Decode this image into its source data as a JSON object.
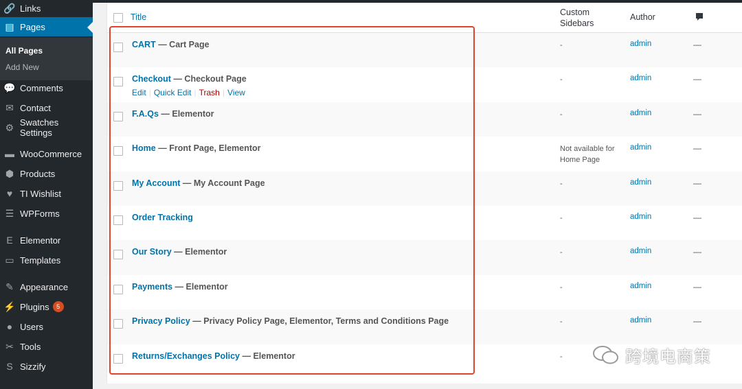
{
  "sidebar": {
    "items": [
      {
        "label": "Links",
        "icon": "link-icon",
        "glyph": "🔗"
      },
      {
        "label": "Pages",
        "icon": "pages-icon",
        "glyph": "▤"
      },
      {
        "label": "Comments",
        "icon": "comment-icon",
        "glyph": "💬"
      },
      {
        "label": "Contact",
        "icon": "mail-icon",
        "glyph": "✉"
      },
      {
        "label": "Swatches Settings",
        "icon": "gear-icon",
        "glyph": "⚙"
      },
      {
        "label": "WooCommerce",
        "icon": "woo-icon",
        "glyph": "▬"
      },
      {
        "label": "Products",
        "icon": "box-icon",
        "glyph": "⬢"
      },
      {
        "label": "TI Wishlist",
        "icon": "heart-icon",
        "glyph": "♥"
      },
      {
        "label": "WPForms",
        "icon": "form-icon",
        "glyph": "☰"
      },
      {
        "label": "Elementor",
        "icon": "elementor-icon",
        "glyph": "E"
      },
      {
        "label": "Templates",
        "icon": "folder-icon",
        "glyph": "▭"
      },
      {
        "label": "Appearance",
        "icon": "brush-icon",
        "glyph": "✎"
      },
      {
        "label": "Plugins",
        "icon": "plug-icon",
        "glyph": "⚡",
        "badge": "5"
      },
      {
        "label": "Users",
        "icon": "user-icon",
        "glyph": "●"
      },
      {
        "label": "Tools",
        "icon": "wrench-icon",
        "glyph": "✂"
      },
      {
        "label": "Sizzify",
        "icon": "sizzify-icon",
        "glyph": "S"
      }
    ],
    "submenu": {
      "all_pages": "All Pages",
      "add_new": "Add New"
    }
  },
  "table": {
    "headers": {
      "title": "Title",
      "custom_sidebars_1": "Custom",
      "custom_sidebars_2": "Sidebars",
      "author": "Author",
      "comments_icon": "comment-bubble-icon"
    },
    "row_actions": {
      "edit": "Edit",
      "quick_edit": "Quick Edit",
      "trash": "Trash",
      "view": "View",
      "sep": "|"
    },
    "rows": [
      {
        "title": "CART",
        "state": "— Cart Page",
        "sidebars": "-",
        "author": "admin",
        "comments": "—"
      },
      {
        "title": "Checkout",
        "state": "— Checkout Page",
        "sidebars": "-",
        "author": "admin",
        "comments": "—"
      },
      {
        "title": "F.A.Qs",
        "state": "— Elementor",
        "sidebars": "-",
        "author": "admin",
        "comments": "—"
      },
      {
        "title": "Home",
        "state": "— Front Page, Elementor",
        "sidebars": "Not available for Home Page",
        "author": "admin",
        "comments": "—"
      },
      {
        "title": "My Account",
        "state": "— My Account Page",
        "sidebars": "-",
        "author": "admin",
        "comments": "—"
      },
      {
        "title": "Order Tracking",
        "state": "",
        "sidebars": "-",
        "author": "admin",
        "comments": "—"
      },
      {
        "title": "Our Story",
        "state": "— Elementor",
        "sidebars": "-",
        "author": "admin",
        "comments": "—"
      },
      {
        "title": "Payments",
        "state": "— Elementor",
        "sidebars": "-",
        "author": "admin",
        "comments": "—"
      },
      {
        "title": "Privacy Policy",
        "state": "— Privacy Policy Page, Elementor, Terms and Conditions Page",
        "sidebars": "-",
        "author": "admin",
        "comments": "—"
      },
      {
        "title": "Returns/Exchanges Policy",
        "state": "— Elementor",
        "sidebars": "-",
        "author": "",
        "comments": ""
      }
    ]
  },
  "watermark": {
    "text": "跨境电商策"
  },
  "colors": {
    "sidebar_bg": "#23282d",
    "active": "#0073aa",
    "link": "#0073aa",
    "highlight": "#e0442c",
    "trash": "#aa0000",
    "badge": "#d54e21"
  }
}
